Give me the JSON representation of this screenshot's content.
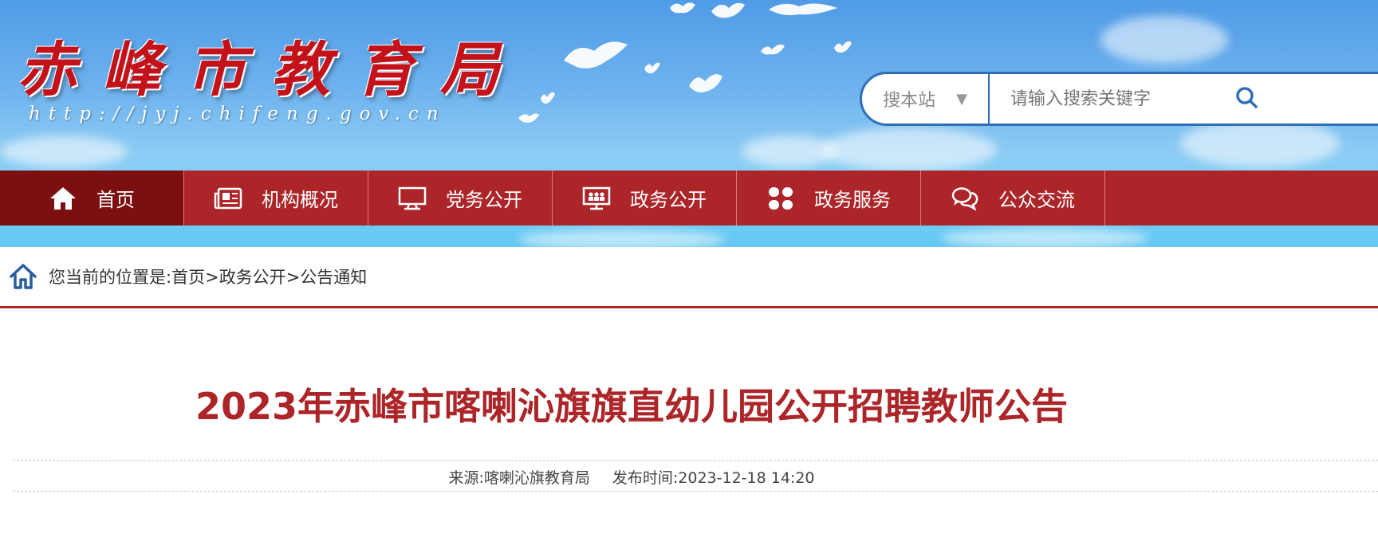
{
  "header": {
    "logo_title": "赤峰市教育局",
    "logo_url": "http://jyj.chifeng.gov.cn"
  },
  "search": {
    "scope_label": "搜本站",
    "scope_caret": "▼",
    "placeholder": "请输入搜索关键字",
    "icon": "search-icon"
  },
  "nav": {
    "items": [
      {
        "label": "首页",
        "icon": "home-icon",
        "active": true
      },
      {
        "label": "机构概况",
        "icon": "newspaper-icon"
      },
      {
        "label": "党务公开",
        "icon": "monitor-icon"
      },
      {
        "label": "政务公开",
        "icon": "presentation-icon"
      },
      {
        "label": "政务服务",
        "icon": "clover-icon"
      },
      {
        "label": "公众交流",
        "icon": "chat-icon"
      }
    ]
  },
  "breadcrumb": {
    "prefix": "您当前的位置是:",
    "items": [
      "首页",
      "政务公开",
      "公告通知"
    ],
    "separator": ">"
  },
  "article": {
    "title": "2023年赤峰市喀喇沁旗旗直幼儿园公开招聘教师公告",
    "source_label": "来源:",
    "source": "喀喇沁旗教育局",
    "date_label": "发布时间:",
    "date": "2023-12-18 14:20"
  },
  "colors": {
    "nav_bg": "#ac2528",
    "nav_active": "#7c1010",
    "title": "#ac2528",
    "search_border": "#2f6fb7"
  }
}
